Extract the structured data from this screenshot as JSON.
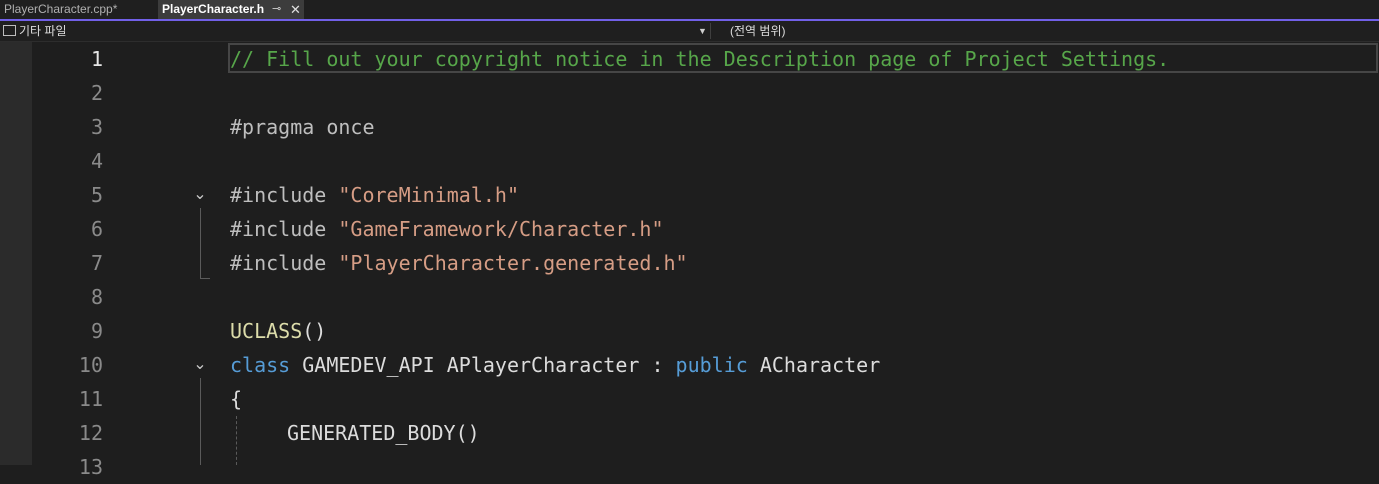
{
  "tabs": [
    {
      "label": "PlayerCharacter.cpp*",
      "active": false
    },
    {
      "label": "PlayerCharacter.h",
      "active": true,
      "pin_icon": "pin-icon",
      "close_icon": "close-icon"
    }
  ],
  "navbar": {
    "project": "기타 파일",
    "scope": "(전역 범위)"
  },
  "colors": {
    "accent": "#7160e8",
    "comment": "#57a64a",
    "string": "#d69d85",
    "keyword": "#569cd6",
    "function_macro": "#dcdcaa"
  },
  "editor": {
    "current_line": 1,
    "lines": [
      {
        "number": "1",
        "parts": [
          "// Fill out your copyright notice in the Description page of Project Settings."
        ]
      },
      {
        "number": "2",
        "parts": []
      },
      {
        "number": "3",
        "parts": [
          "#pragma once"
        ]
      },
      {
        "number": "4",
        "parts": []
      },
      {
        "number": "5",
        "parts": [
          "#include ",
          "\"CoreMinimal.h\""
        ]
      },
      {
        "number": "6",
        "parts": [
          "#include ",
          "\"GameFramework/Character.h\""
        ]
      },
      {
        "number": "7",
        "parts": [
          "#include ",
          "\"PlayerCharacter.generated.h\""
        ]
      },
      {
        "number": "8",
        "parts": []
      },
      {
        "number": "9",
        "parts": [
          "UCLASS",
          "()"
        ]
      },
      {
        "number": "10",
        "parts": [
          "class",
          " GAMEDEV_API APlayerCharacter : ",
          "public",
          " ACharacter"
        ]
      },
      {
        "number": "11",
        "parts": [
          "{"
        ]
      },
      {
        "number": "12",
        "parts": [
          "GENERATED_BODY()"
        ]
      },
      {
        "number": "13",
        "parts": []
      }
    ]
  }
}
